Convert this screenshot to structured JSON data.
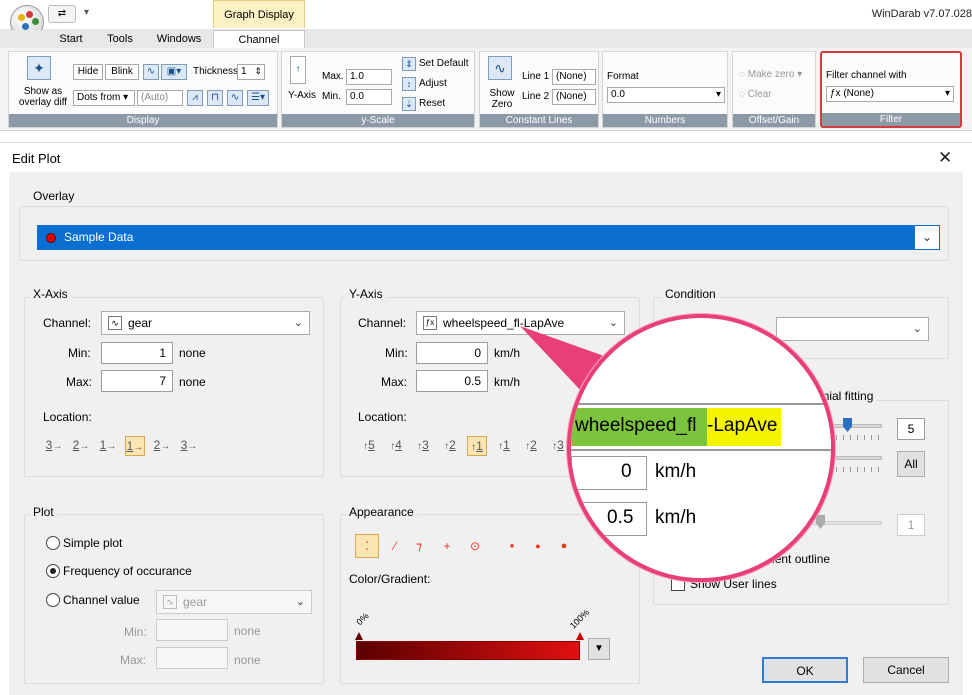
{
  "app": {
    "title": "WinDarab v7.07.028",
    "context_tab": "Graph Display",
    "tabs": [
      "Start",
      "Tools",
      "Windows",
      "Channel"
    ],
    "active_tab": "Channel",
    "accent_color": "#2b7bd4",
    "highlight_color": "#e83f76"
  },
  "ribbon": {
    "display": {
      "overlay_label": "Show as overlay diff",
      "hide": "Hide",
      "blink": "Blink",
      "thickness_label": "Thickness",
      "thickness_value": "1",
      "dots_from_label": "Dots from",
      "dots_from_value": "(Auto)",
      "group_label": "Display"
    },
    "yscale": {
      "yaxis_label": "Y-Axis",
      "max_label": "Max.",
      "max_value": "1.0",
      "min_label": "Min.",
      "min_value": "0.0",
      "set_default": "Set Default",
      "adjust": "Adjust",
      "reset": "Reset",
      "group_label": "y-Scale"
    },
    "constant_lines": {
      "show_zero": "Show Zero",
      "line1_label": "Line 1",
      "line1_value": "(None)",
      "line2_label": "Line 2",
      "line2_value": "(None)",
      "group_label": "Constant Lines"
    },
    "numbers": {
      "format_label": "Format",
      "format_value": "0.0",
      "group_label": "Numbers"
    },
    "offset_gain": {
      "make_zero": "Make zero",
      "clear": "Clear",
      "group_label": "Offset/Gain"
    },
    "filter": {
      "label": "Filter channel with",
      "value": "(None)",
      "group_label": "Filter"
    }
  },
  "dialog": {
    "title": "Edit Plot",
    "overlay": {
      "legend": "Overlay",
      "selected": "Sample Data",
      "dot_color": "#e00000"
    },
    "xaxis": {
      "legend": "X-Axis",
      "channel_label": "Channel:",
      "channel_value": "gear",
      "min_label": "Min:",
      "min_value": "1",
      "min_unit": "none",
      "max_label": "Max:",
      "max_value": "7",
      "max_unit": "none",
      "location_label": "Location:",
      "locations": [
        "3",
        "2",
        "1",
        "1",
        "2",
        "3"
      ],
      "selected_location": 3
    },
    "yaxis": {
      "legend": "Y-Axis",
      "channel_label": "Channel:",
      "channel_value": "wheelspeed_fl-LapAve",
      "min_label": "Min:",
      "min_value": "0",
      "min_unit": "km/h",
      "max_label": "Max:",
      "max_value": "0.5",
      "max_unit": "km/h",
      "location_label": "Location:",
      "locations": [
        "5",
        "4",
        "3",
        "2",
        "1",
        "1",
        "2",
        "3"
      ],
      "selected_location": 4
    },
    "condition": {
      "legend": "Condition",
      "condition_label": "ition:",
      "condition_value": ""
    },
    "polynomial": {
      "legend": "nomial fitting",
      "degree_value": "5",
      "all_label": "All",
      "partial_label": "e",
      "partial_label2": "m:",
      "partial_value": "1",
      "show_component_outline": "w component outline",
      "show_user_lines": "Show User lines"
    },
    "plot": {
      "legend": "Plot",
      "simple_plot": "Simple plot",
      "frequency": "Frequency of occurance",
      "channel_value": "Channel value",
      "channel_combo": "gear",
      "selected": "frequency",
      "min_label": "Min:",
      "min_unit": "none",
      "max_label": "Max:",
      "max_unit": "none"
    },
    "appearance": {
      "legend": "Appearance",
      "color_label": "Color/Gradient:",
      "gradient_start_label": "0%",
      "gradient_end_label": "100%",
      "gradient_from": "#5a0000",
      "gradient_to": "#e01010"
    },
    "buttons": {
      "ok": "OK",
      "cancel": "Cancel"
    },
    "magnifier": {
      "channel_part1": "wheelspeed_fl",
      "channel_part2": "-LapAve",
      "min_value": "0",
      "min_unit": "km/h",
      "max_value": "0.5",
      "max_unit": "km/h",
      "green": "#7cc33e",
      "yellow": "#f4f400"
    }
  }
}
